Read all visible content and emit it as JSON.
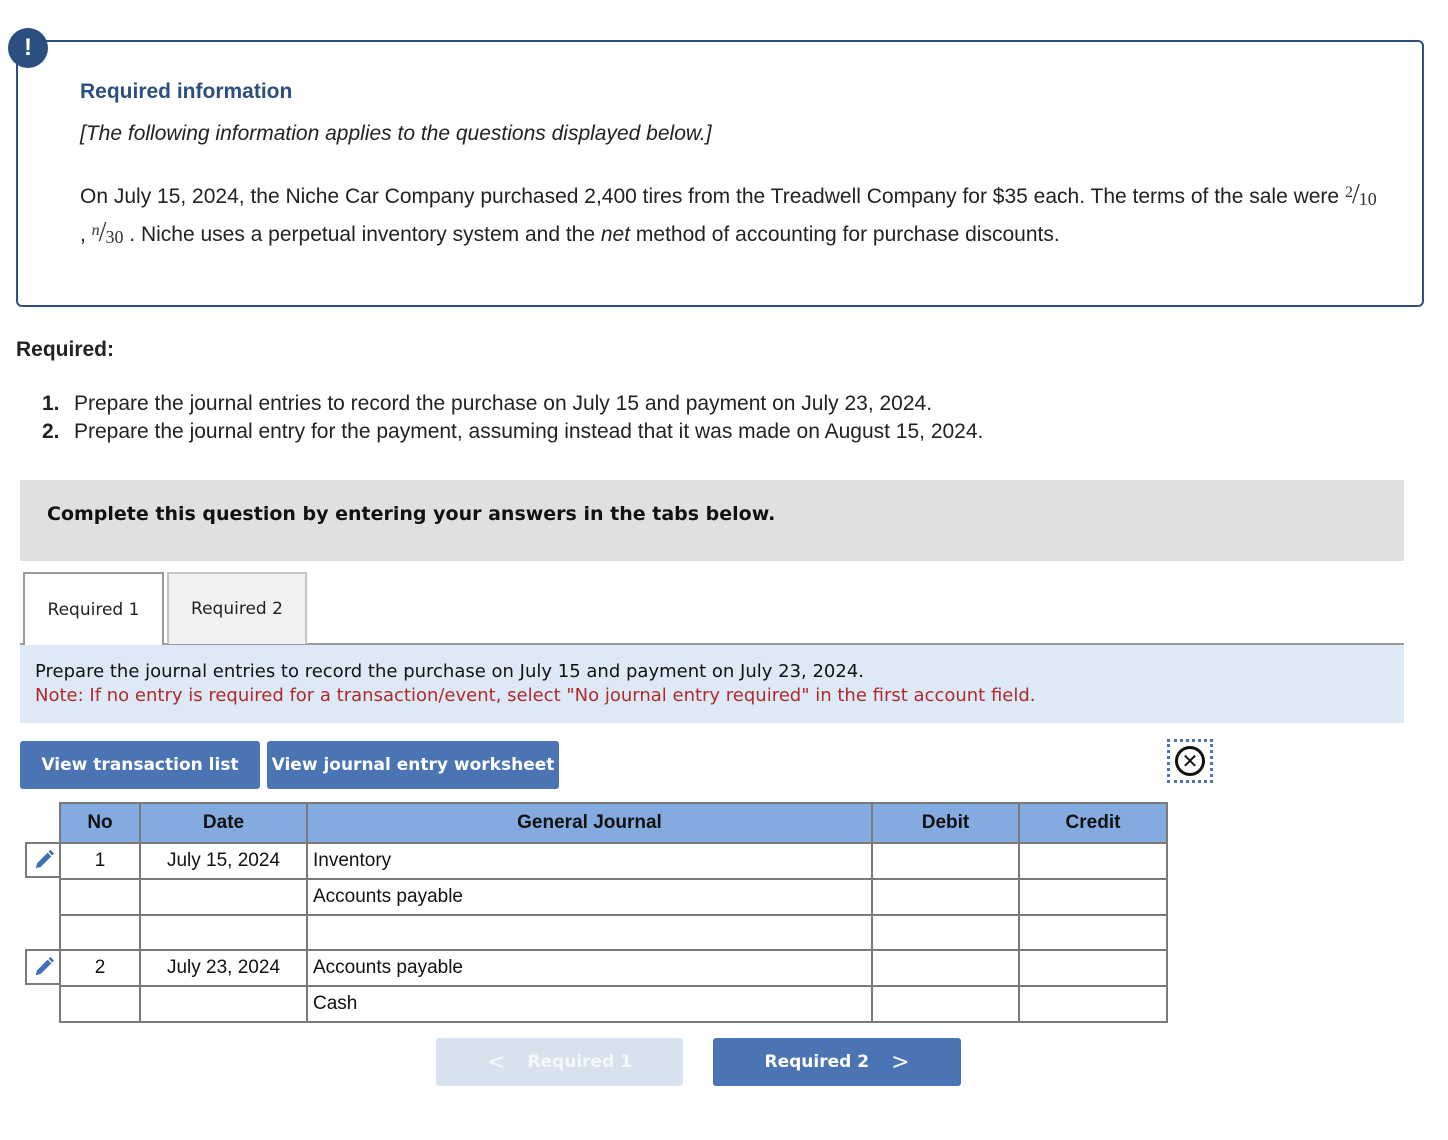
{
  "info_box": {
    "icon": "alert-exclamation-icon",
    "icon_glyph": "!",
    "title": "Required information",
    "subtitle": "[The following information applies to the questions displayed below.]",
    "body_part1": "On July 15, 2024, the Niche Car Company purchased 2,400 tires from the Treadwell Company for $35 each. The terms of the sale were ",
    "term1_num": "2",
    "term1_den": "10",
    "term_sep": " , ",
    "term2_num": "n",
    "term2_den": "30",
    "body_part2": " . Niche uses a perpetual inventory system and the ",
    "body_emph": "net",
    "body_part3": " method of accounting for purchase discounts."
  },
  "required": {
    "heading": "Required:",
    "items": [
      {
        "num": "1.",
        "text": "Prepare the journal entries to record the purchase on July 15 and payment on July 23, 2024."
      },
      {
        "num": "2.",
        "text": "Prepare the journal entry for the payment, assuming instead that it was made on August 15, 2024."
      }
    ]
  },
  "banner": {
    "text": "Complete this question by entering your answers in the tabs below."
  },
  "tabs": [
    {
      "label": "Required 1",
      "active": true
    },
    {
      "label": "Required 2",
      "active": false
    }
  ],
  "instructions": {
    "main": "Prepare the journal entries to record the purchase on July 15 and payment on July 23, 2024.",
    "note": "Note: If no entry is required for a transaction/event, select \"No journal entry required\" in the first account field."
  },
  "buttons": {
    "view_transaction_list": "View transaction list",
    "view_journal_worksheet": "View journal entry worksheet",
    "close_icon": "close-circle-icon",
    "close_glyph": "✕"
  },
  "journal": {
    "headers": [
      "No",
      "Date",
      "General Journal",
      "Debit",
      "Credit"
    ],
    "rows": [
      {
        "no": "1",
        "date": "July 15, 2024",
        "account": "Inventory",
        "debit": "",
        "credit": ""
      },
      {
        "no": "",
        "date": "",
        "account": "Accounts payable",
        "debit": "",
        "credit": ""
      },
      {
        "no": "",
        "date": "",
        "account": "",
        "debit": "",
        "credit": ""
      },
      {
        "no": "2",
        "date": "July 23, 2024",
        "account": "Accounts payable",
        "debit": "",
        "credit": ""
      },
      {
        "no": "",
        "date": "",
        "account": "Cash",
        "debit": "",
        "credit": ""
      }
    ]
  },
  "nav": {
    "prev_label": "Required 1",
    "prev_glyph": "<",
    "next_label": "Required 2",
    "next_glyph": ">"
  },
  "colors": {
    "navy": "#2b4f7e",
    "button_blue": "#4a74b4",
    "table_header": "#84abdf",
    "instruction_bg": "#dde9f7",
    "note_red": "#b02a2a",
    "banner_gray": "#e0e0e0",
    "disabled_btn": "#d8e2ee"
  }
}
